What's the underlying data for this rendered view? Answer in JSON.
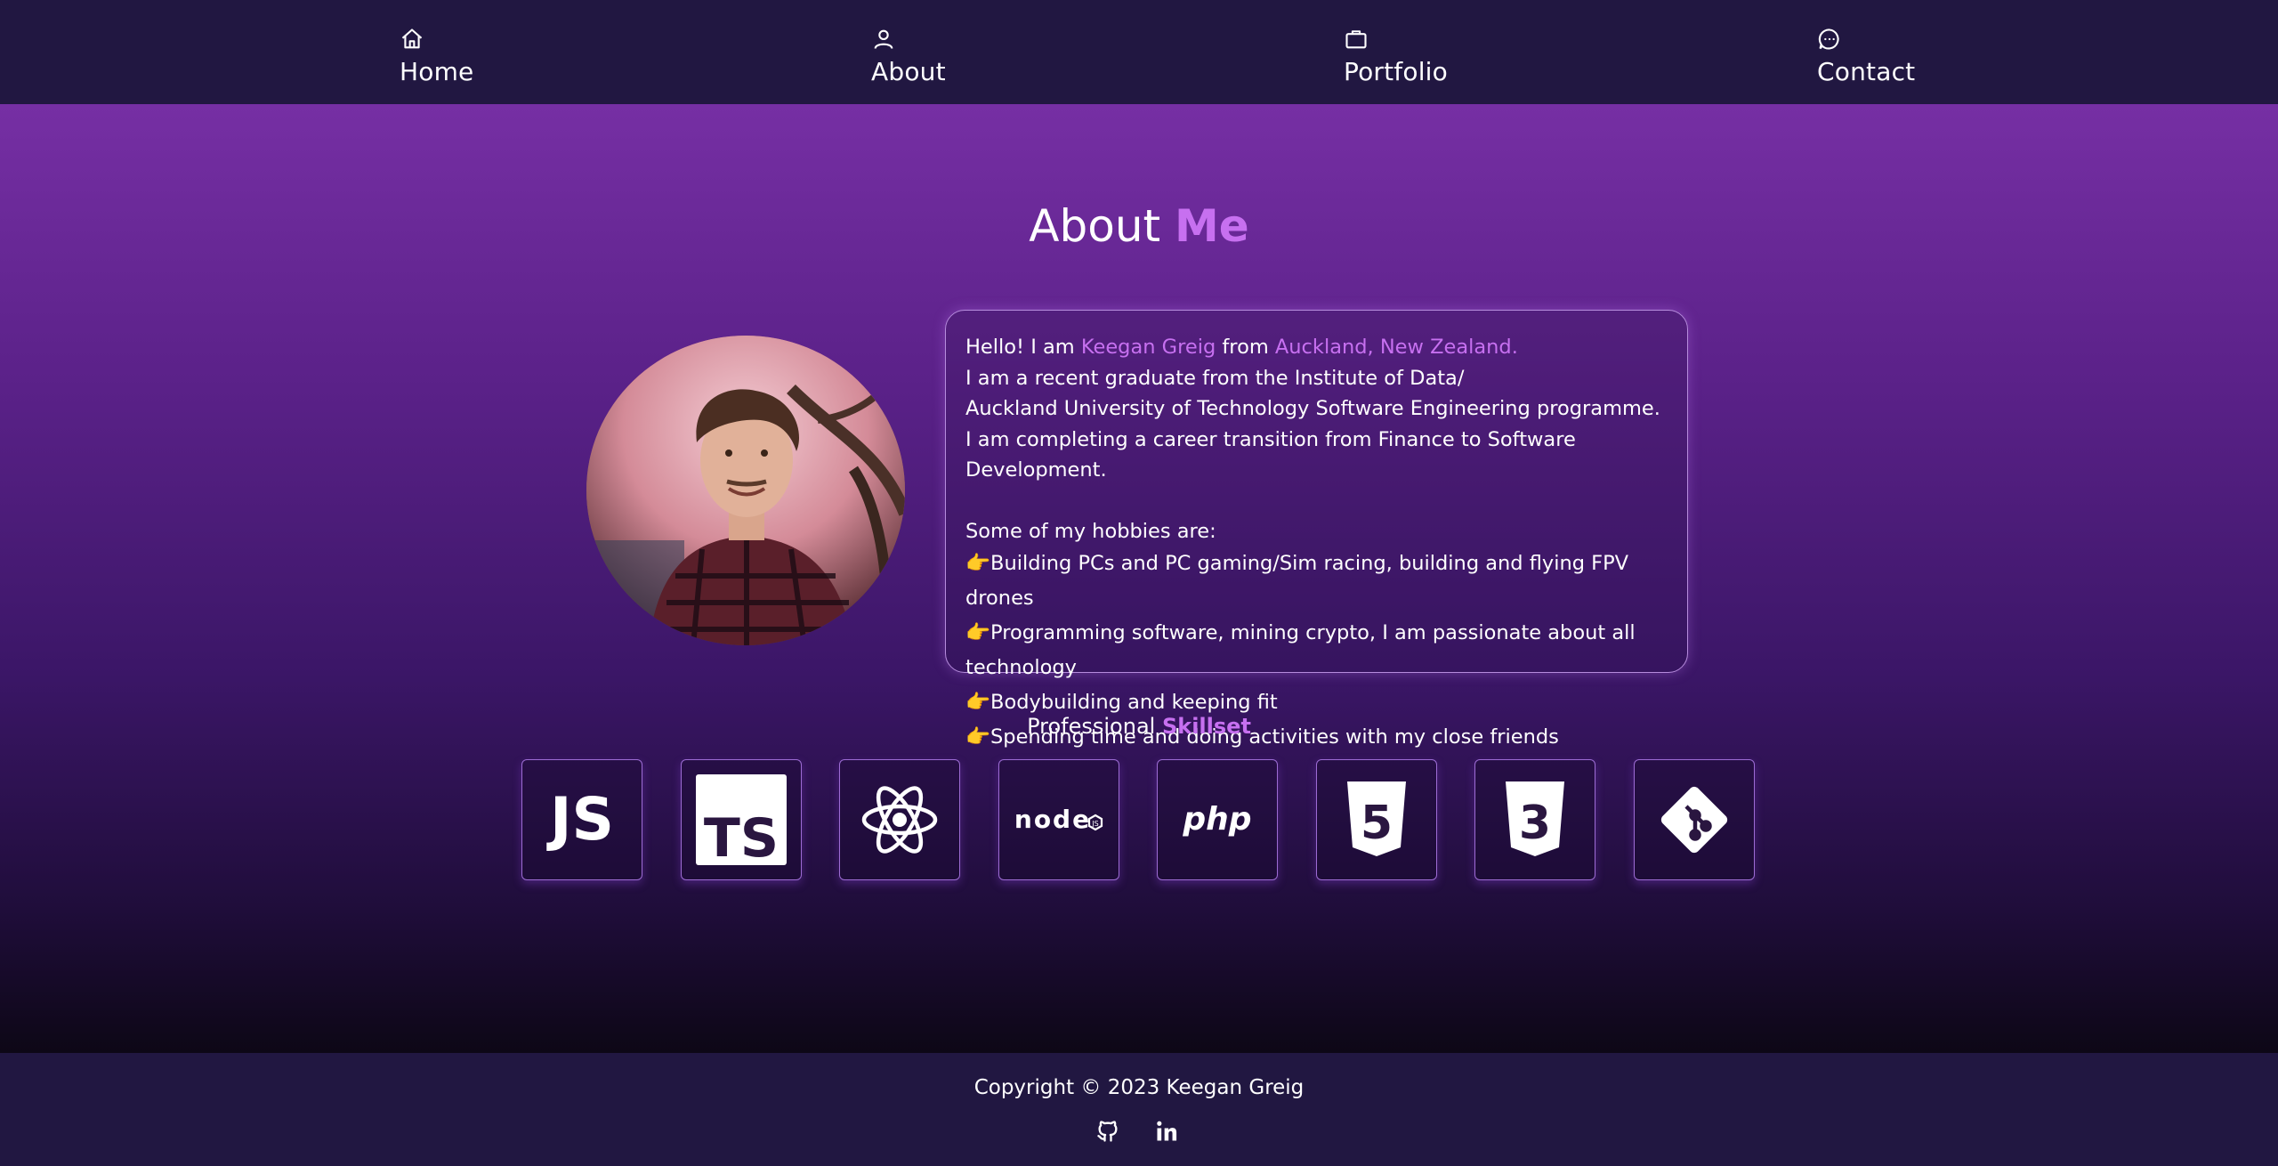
{
  "nav": {
    "items": [
      {
        "label": "Home",
        "icon": "home-icon"
      },
      {
        "label": "About",
        "icon": "user-icon"
      },
      {
        "label": "Portfolio",
        "icon": "briefcase-icon"
      },
      {
        "label": "Contact",
        "icon": "chat-icon"
      }
    ]
  },
  "about": {
    "title_prefix": "About ",
    "title_accent": "Me",
    "avatar_icon": "profile-photo"
  },
  "bio": {
    "greeting": "Hello! I am ",
    "name": "Keegan Greig",
    "from": " from ",
    "location": "Auckland, New Zealand.",
    "line2": "I am a recent graduate from the Institute of Data/",
    "line3": "Auckland University of Technology Software Engineering programme.",
    "line4": "I am completing a career transition from Finance to Software Development.",
    "hobbies_heading": "Some of my hobbies are:",
    "hobby_bullet": "👉",
    "hobbies": [
      "Building PCs and PC gaming/Sim racing, building and flying FPV drones",
      "Programming software, mining crypto, I am passionate about all technology",
      "Bodybuilding and keeping fit",
      "Spending time and doing activities with my close friends"
    ]
  },
  "skills": {
    "heading_prefix": "Professional ",
    "heading_accent": "Skillset",
    "items": [
      {
        "icon": "javascript-icon",
        "text": "JS"
      },
      {
        "icon": "typescript-icon",
        "text": "TS"
      },
      {
        "icon": "react-icon",
        "text": ""
      },
      {
        "icon": "nodejs-icon",
        "text": "node"
      },
      {
        "icon": "php-icon",
        "text": "php"
      },
      {
        "icon": "html5-icon",
        "text": "5"
      },
      {
        "icon": "css3-icon",
        "text": "3"
      },
      {
        "icon": "git-icon",
        "text": ""
      }
    ]
  },
  "footer": {
    "copyright": "Copyright © 2023 Keegan Greig",
    "social": [
      "github-icon",
      "linkedin-icon"
    ]
  },
  "colors": {
    "accent": "#c770f0",
    "nav_bg": "#211741",
    "gradient_top": "#762fa4",
    "gradient_bottom": "#0d0716"
  }
}
